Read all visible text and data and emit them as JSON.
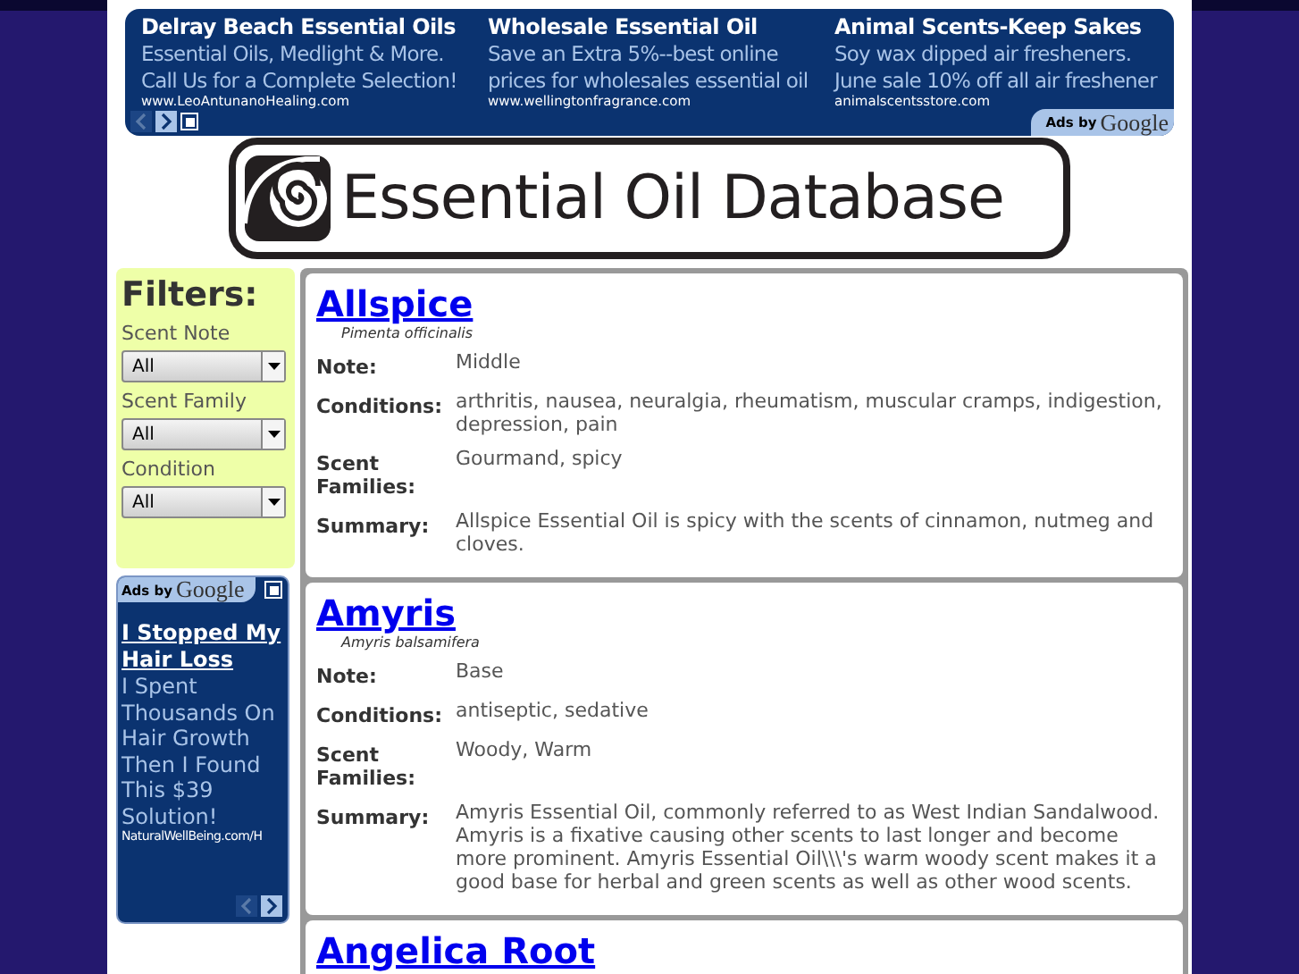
{
  "top_ad": {
    "ads": [
      {
        "title": "Delray Beach Essential Oils",
        "text": "Essential Oils, Medlight & More. Call Us for a Complete Selection!",
        "url": "www.LeoAntunanoHealing.com"
      },
      {
        "title": "Wholesale Essential Oil",
        "text": "Save an Extra 5%--best online prices for wholesales essential oil",
        "url": "www.wellingtonfragrance.com"
      },
      {
        "title": "Animal Scents-Keep Sakes",
        "text": "Soy wax dipped air fresheners. June sale 10% off all air freshener",
        "url": "animalscentsstore.com"
      }
    ],
    "badge_prefix": "Ads by",
    "badge_brand": "Google"
  },
  "logo": {
    "title": "Essential Oil Database"
  },
  "filters": {
    "title": "Filters:",
    "groups": [
      {
        "label": "Scent Note",
        "value": "All"
      },
      {
        "label": "Scent Family",
        "value": "All"
      },
      {
        "label": "Condition",
        "value": "All"
      }
    ]
  },
  "side_ad": {
    "badge_prefix": "Ads by",
    "badge_brand": "Google",
    "title": "I Stopped My Hair Loss",
    "text": "I Spent Thousands On Hair Growth Then I Found This $39 Solution!",
    "url": "NaturalWellBeing.com/H"
  },
  "oils": [
    {
      "name": "Allspice",
      "latin": "Pimenta officinalis",
      "fields": [
        {
          "label": "Note:",
          "value": "Middle"
        },
        {
          "label": "Conditions:",
          "value": "arthritis, nausea, neuralgia, rheumatism, muscular cramps, indigestion, depression, pain"
        },
        {
          "label": "Scent Families:",
          "value": "Gourmand, spicy"
        },
        {
          "label": "Summary:",
          "value": "Allspice Essential Oil is spicy with the scents of cinnamon, nutmeg and cloves."
        }
      ]
    },
    {
      "name": "Amyris",
      "latin": "Amyris balsamifera",
      "fields": [
        {
          "label": "Note:",
          "value": "Base"
        },
        {
          "label": "Conditions:",
          "value": "antiseptic, sedative"
        },
        {
          "label": "Scent Families:",
          "value": "Woody, Warm"
        },
        {
          "label": "Summary:",
          "value": "Amyris Essential Oil, commonly referred to as West Indian Sandalwood. Amyris is a fixative causing other scents to last longer and become more prominent. Amyris Essential Oil\\\\\\'s warm woody scent makes it a good base for herbal and green scents as well as other wood scents."
        }
      ]
    },
    {
      "name": "Angelica Root"
    }
  ]
}
